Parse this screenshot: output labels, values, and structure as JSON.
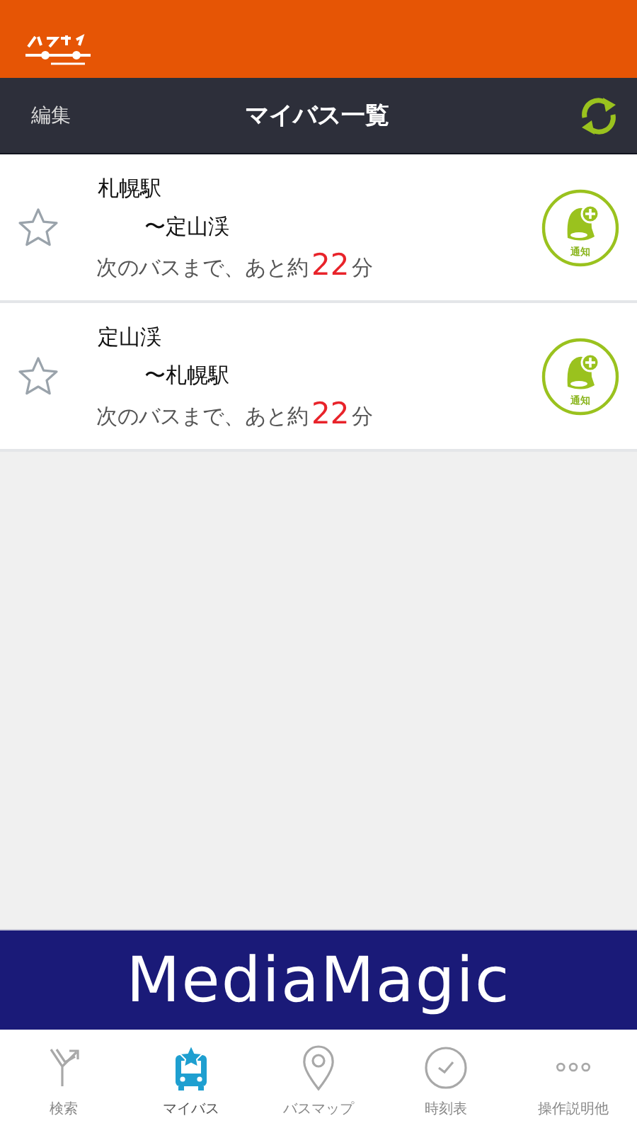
{
  "header": {
    "edit": "編集",
    "title": "マイバス一覧"
  },
  "routes": [
    {
      "from": "札幌駅",
      "to": "〜定山渓",
      "next_label": "次のバスまで、あと約",
      "minutes": "22",
      "unit": "分",
      "starred": false,
      "notify_label": "通知"
    },
    {
      "from": "定山渓",
      "to": "〜札幌駅",
      "next_label": "次のバスまで、あと約",
      "minutes": "22",
      "unit": "分",
      "starred": false,
      "notify_label": "通知"
    }
  ],
  "banner": {
    "text": "MediaMagic"
  },
  "tabs": [
    {
      "kind": "search",
      "label": "検索",
      "selected": false
    },
    {
      "kind": "mybus",
      "label": "マイバス",
      "selected": true
    },
    {
      "kind": "map",
      "label": "バスマップ",
      "selected": false
    },
    {
      "kind": "timetable",
      "label": "時刻表",
      "selected": false
    },
    {
      "kind": "more",
      "label": "操作説明他",
      "selected": false
    }
  ]
}
